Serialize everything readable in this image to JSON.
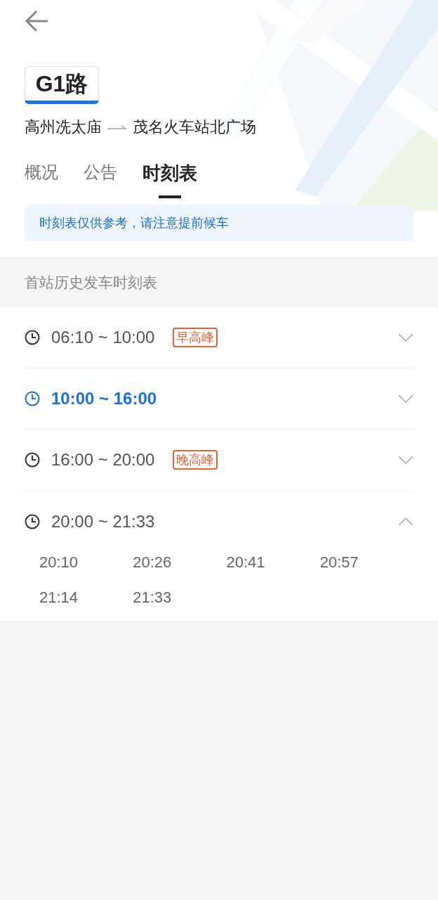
{
  "header": {
    "badge": "G1路",
    "from": "高州冼太庙",
    "to": "茂名火车站北广场"
  },
  "tabs": [
    {
      "label": "概况",
      "selected": false
    },
    {
      "label": "公告",
      "selected": false
    },
    {
      "label": "时刻表",
      "selected": true
    }
  ],
  "notice": "时刻表仅供参考，请注意提前候车",
  "section_title": "首站历史发车时刻表",
  "periods": [
    {
      "range": "06:10 ~ 10:00",
      "tag": "早高峰",
      "current": false,
      "expanded": false
    },
    {
      "range": "10:00 ~ 16:00",
      "current": true,
      "expanded": false
    },
    {
      "range": "16:00 ~ 20:00",
      "tag": "晚高峰",
      "current": false,
      "expanded": false
    },
    {
      "range": "20:00 ~ 21:33",
      "current": false,
      "expanded": true,
      "times": [
        "20:10",
        "20:26",
        "20:41",
        "20:57",
        "21:14",
        "21:33"
      ]
    }
  ]
}
